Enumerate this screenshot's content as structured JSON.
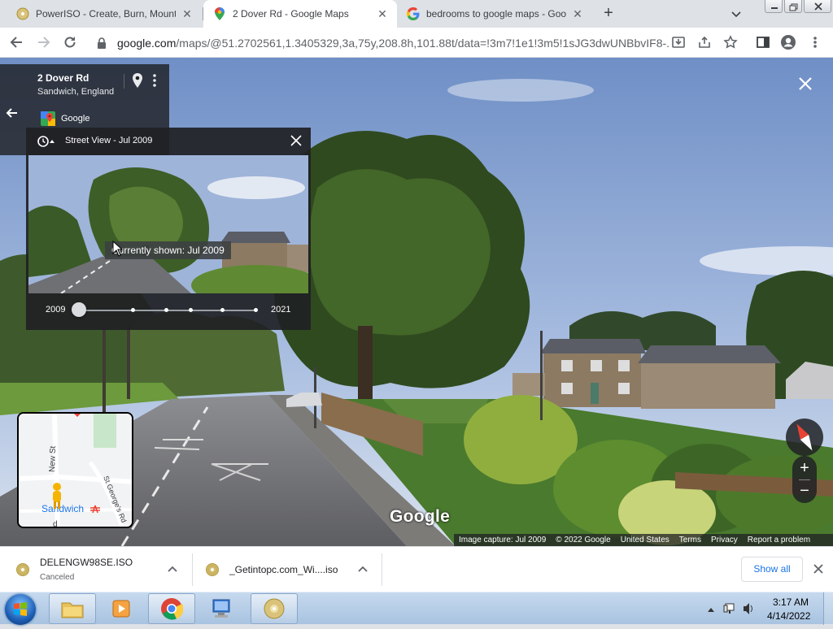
{
  "browser": {
    "tabs": [
      {
        "title": "PowerISO - Create, Burn, Mount,",
        "icon": "poweriso-icon"
      },
      {
        "title": "2 Dover Rd - Google Maps",
        "icon": "google-maps-icon"
      },
      {
        "title": "bedrooms to google maps - Goo",
        "icon": "google-icon"
      }
    ],
    "active_tab": 1,
    "url_host": "google.com",
    "url_path": "/maps/@51.2702561,1.3405329,3a,75y,208.8h,101.88t/data=!3m7!1e1!3m5!1sJG3dwUNBbvIF8-..."
  },
  "place": {
    "title": "2 Dover Rd",
    "subtitle": "Sandwich, England",
    "source_label": "Google"
  },
  "time_machine": {
    "title": "Street View - Jul 2009",
    "tooltip": "Currently shown: Jul 2009",
    "start_label": "2009",
    "end_label": "2021",
    "selected_position": 0
  },
  "minimap": {
    "street_labels": [
      "New St",
      "St George's Rd"
    ],
    "town_label": "Sandwich",
    "partial_label": "d"
  },
  "watermark": "Google",
  "footer": {
    "capture": "Image capture: Jul 2009",
    "copyright": "© 2022 Google",
    "country": "United States",
    "terms": "Terms",
    "privacy": "Privacy",
    "report": "Report a problem"
  },
  "downloads": {
    "items": [
      {
        "name": "DELENGW98SE.ISO",
        "status": "Canceled"
      },
      {
        "name": "_Getintopc.com_Wi....iso",
        "status": ""
      }
    ],
    "show_all": "Show all"
  },
  "taskbar": {
    "time": "3:17 AM",
    "date": "4/14/2022"
  },
  "colors": {
    "link_blue": "#1a73e8",
    "panel_dark": "#202124"
  }
}
